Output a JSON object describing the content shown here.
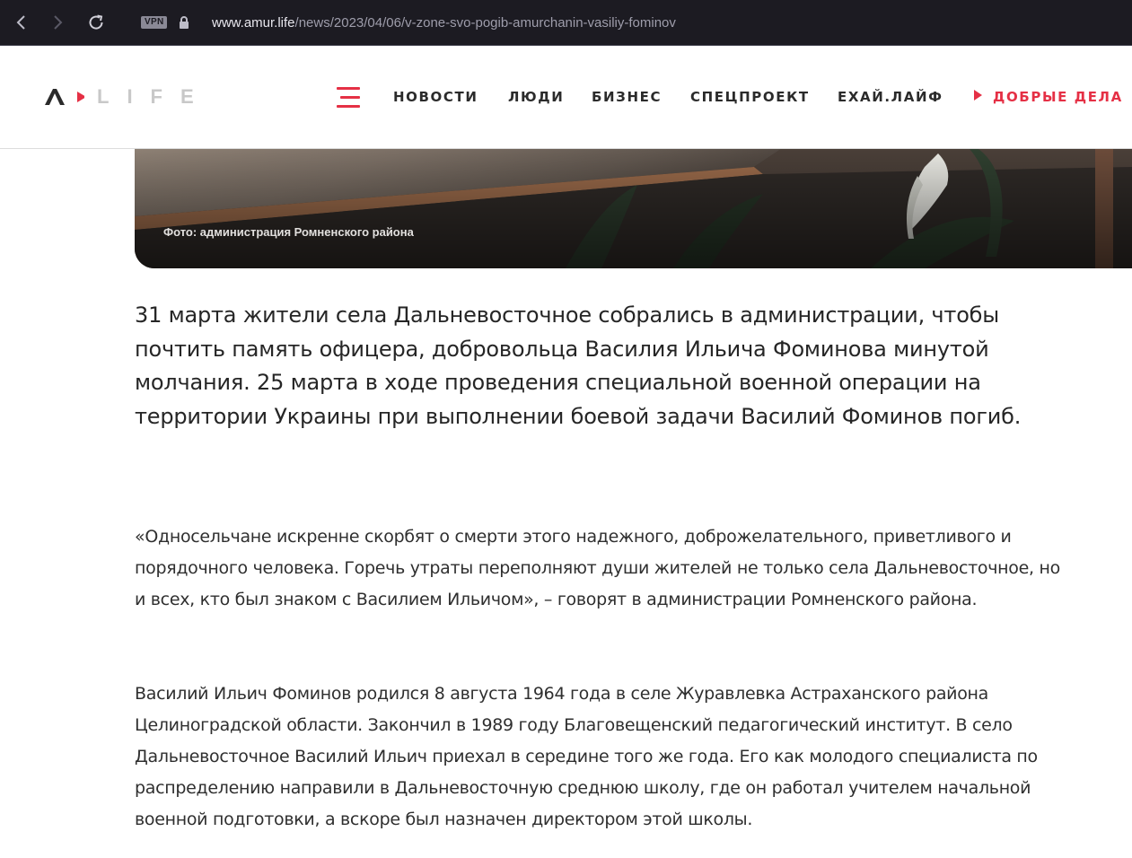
{
  "browser": {
    "vpn_label": "VPN",
    "url_host": "www.amur.life",
    "url_path": "/news/2023/04/06/v-zone-svo-pogib-amurchanin-vasiliy-fominov"
  },
  "site": {
    "logo_text": "LIFE",
    "menu": [
      {
        "label": "НОВОСТИ"
      },
      {
        "label": "ЛЮДИ"
      },
      {
        "label": "БИЗНЕС"
      },
      {
        "label": "СПЕЦПРОЕКТ"
      },
      {
        "label": "ЕХАЙ.ЛАЙФ"
      },
      {
        "label": "ДОБРЫЕ ДЕЛА"
      }
    ],
    "colors": {
      "accent": "#e53045",
      "text": "#2b2b2b"
    }
  },
  "article": {
    "photo_caption": "Фото: администрация Ромненского района",
    "lead": "31 марта жители села Дальневосточное собрались в администрации, чтобы почтить память офицера, добровольца Василия Ильича Фоминова минутой молчания. 25 марта в ходе проведения специальной военной операции на территории Украины при выполнении боевой задачи Василий Фоминов погиб.",
    "paragraphs": [
      "«Односельчане искренне скорбят о смерти этого надежного, доброжелательного, приветливого и порядочного человека. Горечь утраты переполняют души жителей не только села Дальневосточное, но и всех, кто был знаком с Василием Ильичом», – говорят в администрации Ромненского района.",
      "Василий Ильич Фоминов родился 8 августа 1964 года в селе Журавлевка Астраханского района Целиноградской области. Закончил в 1989 году Благовещенский педагогический институт. В село Дальневосточное Василий Ильич приехал в середине того же года. Его как молодого специалиста по распределению направили в Дальневосточную среднюю школу, где он работал учителем начальной военной подготовки, а вскоре был назначен директором этой школы."
    ]
  }
}
